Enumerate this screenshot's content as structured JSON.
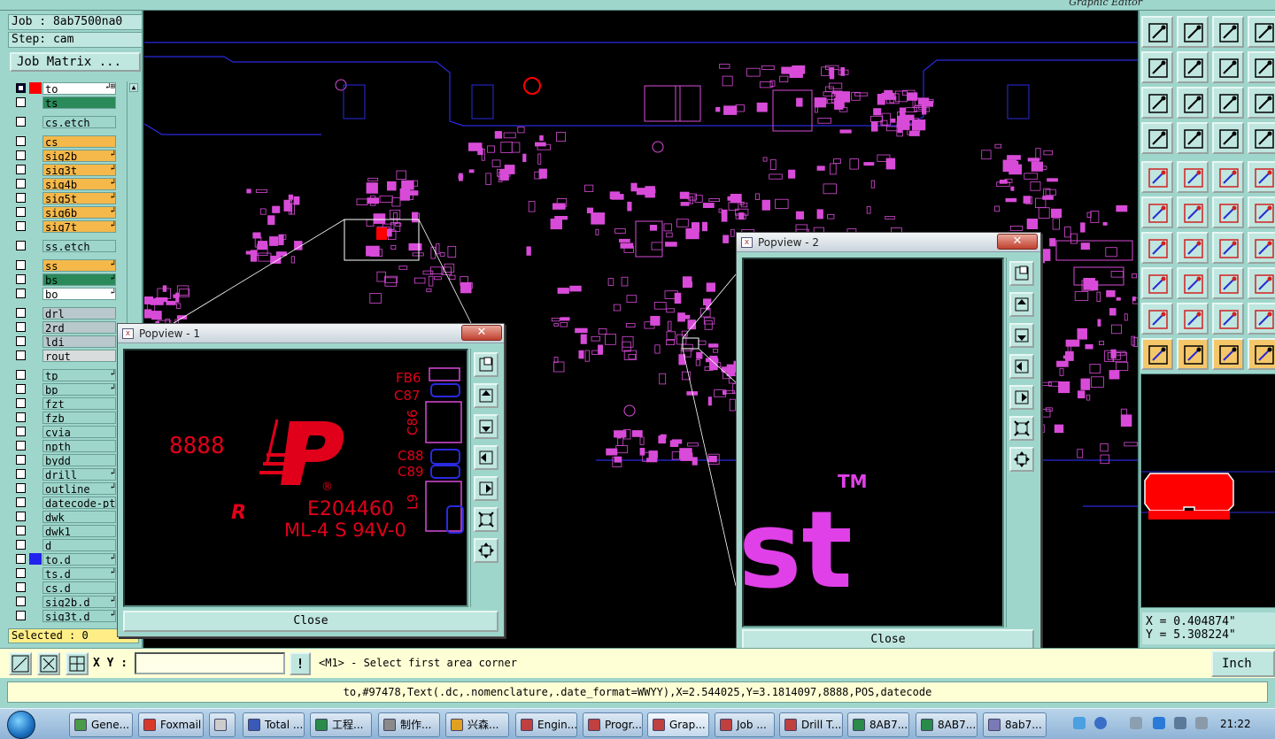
{
  "app": {
    "window_title": "Graphic Editor"
  },
  "job": {
    "job_label": "Job : 8ab7500na0",
    "step_label": "Step: cam",
    "matrix_button": "Job Matrix ..."
  },
  "colors": {
    "panel": "#9fd6cc",
    "accent_orange": "#f5b84a",
    "accent_green": "#2a8a5a",
    "layer_cyan": "#9fd6cc",
    "board_magenta": "#d84bd8",
    "board_blue": "#2a2ae0",
    "feature_red": "#ff0000"
  },
  "layers": [
    {
      "name": "to",
      "bg": "#ffffff",
      "swatch": "#ff0000",
      "on": true,
      "flag": "↲⊞"
    },
    {
      "name": "ts",
      "bg": "#2a8a5a",
      "swatch": "",
      "on": false,
      "flag": ""
    },
    {
      "name": "cs.etch",
      "bg": "#9fd6cc",
      "swatch": "",
      "on": false,
      "flag": ""
    },
    {
      "name": "cs",
      "bg": "#f5b84a",
      "swatch": "",
      "on": false,
      "flag": ""
    },
    {
      "name": "sig2b",
      "bg": "#f5b84a",
      "swatch": "",
      "on": false,
      "flag": "↲"
    },
    {
      "name": "sig3t",
      "bg": "#f5b84a",
      "swatch": "",
      "on": false,
      "flag": "↲"
    },
    {
      "name": "sig4b",
      "bg": "#f5b84a",
      "swatch": "",
      "on": false,
      "flag": "↲"
    },
    {
      "name": "sig5t",
      "bg": "#f5b84a",
      "swatch": "",
      "on": false,
      "flag": "↲"
    },
    {
      "name": "sig6b",
      "bg": "#f5b84a",
      "swatch": "",
      "on": false,
      "flag": "↲"
    },
    {
      "name": "sig7t",
      "bg": "#f5b84a",
      "swatch": "",
      "on": false,
      "flag": "↲"
    },
    {
      "name": "ss.etch",
      "bg": "#9fd6cc",
      "swatch": "",
      "on": false,
      "flag": ""
    },
    {
      "name": "ss",
      "bg": "#f5b84a",
      "swatch": "",
      "on": false,
      "flag": "↲"
    },
    {
      "name": "bs",
      "bg": "#2a8a5a",
      "swatch": "",
      "on": false,
      "flag": "↲"
    },
    {
      "name": "bo",
      "bg": "#ffffff",
      "swatch": "",
      "on": false,
      "flag": "↲"
    },
    {
      "name": "drl",
      "bg": "#b9c8cc",
      "swatch": "",
      "on": false,
      "flag": ""
    },
    {
      "name": "2rd",
      "bg": "#b9c8cc",
      "swatch": "",
      "on": false,
      "flag": ""
    },
    {
      "name": "ldi",
      "bg": "#b9c8cc",
      "swatch": "",
      "on": false,
      "flag": ""
    },
    {
      "name": "rout",
      "bg": "#d9dcdc",
      "swatch": "",
      "on": false,
      "flag": ""
    },
    {
      "name": "tp",
      "bg": "#9fd6cc",
      "swatch": "",
      "on": false,
      "flag": "↲"
    },
    {
      "name": "bp",
      "bg": "#9fd6cc",
      "swatch": "",
      "on": false,
      "flag": "↲"
    },
    {
      "name": "fzt",
      "bg": "#9fd6cc",
      "swatch": "",
      "on": false,
      "flag": ""
    },
    {
      "name": "fzb",
      "bg": "#9fd6cc",
      "swatch": "",
      "on": false,
      "flag": ""
    },
    {
      "name": "cvia",
      "bg": "#9fd6cc",
      "swatch": "",
      "on": false,
      "flag": ""
    },
    {
      "name": "npth",
      "bg": "#9fd6cc",
      "swatch": "",
      "on": false,
      "flag": ""
    },
    {
      "name": "bydd",
      "bg": "#9fd6cc",
      "swatch": "",
      "on": false,
      "flag": ""
    },
    {
      "name": "drill",
      "bg": "#9fd6cc",
      "swatch": "",
      "on": false,
      "flag": "↲"
    },
    {
      "name": "outline",
      "bg": "#9fd6cc",
      "swatch": "",
      "on": false,
      "flag": "↲"
    },
    {
      "name": "datecode-pte",
      "bg": "#9fd6cc",
      "swatch": "",
      "on": false,
      "flag": ""
    },
    {
      "name": "dwk",
      "bg": "#9fd6cc",
      "swatch": "",
      "on": false,
      "flag": ""
    },
    {
      "name": "dwk1",
      "bg": "#9fd6cc",
      "swatch": "",
      "on": false,
      "flag": ""
    },
    {
      "name": "d",
      "bg": "#9fd6cc",
      "swatch": "",
      "on": false,
      "flag": ""
    },
    {
      "name": "to.d",
      "bg": "#9fd6cc",
      "swatch": "#2222ee",
      "on": false,
      "flag": "↲"
    },
    {
      "name": "ts.d",
      "bg": "#9fd6cc",
      "swatch": "",
      "on": false,
      "flag": "↲"
    },
    {
      "name": "cs.d",
      "bg": "#9fd6cc",
      "swatch": "",
      "on": false,
      "flag": ""
    },
    {
      "name": "sig2b.d",
      "bg": "#9fd6cc",
      "swatch": "",
      "on": false,
      "flag": "↲"
    },
    {
      "name": "sig3t.d",
      "bg": "#9fd6cc",
      "swatch": "",
      "on": false,
      "flag": "↲"
    }
  ],
  "selected_label": "Selected : 0",
  "popview1": {
    "title": "Popview - 1",
    "close_x": "✕",
    "close_button": "Close",
    "marking": {
      "digits": "8888",
      "cert": "E204460",
      "rating": "ML-4 S 94V-0",
      "ul": "R",
      "reg": "®"
    },
    "refdes": [
      "FB6",
      "C87",
      "C86",
      "C88",
      "C89",
      "L9"
    ]
  },
  "popview2": {
    "title": "Popview - 2",
    "close_x": "✕",
    "close_button": "Close",
    "logo_text": "st",
    "tm": "TM"
  },
  "coords": {
    "x": "X = 0.404874\"",
    "y": "Y = 5.308224\""
  },
  "command": {
    "xy_label": "X Y :",
    "xy_value": "",
    "excl": "!",
    "prompt": "<M1> - Select first area corner",
    "units": "Inch"
  },
  "status": {
    "text": "to,#97478,Text(.dc,.nomenclature,.date_format=WWYY),X=2.544025,Y=3.1814097,8888,POS,datecode"
  },
  "taskbar": {
    "items": [
      {
        "label": "Gene...",
        "color": "#4a9a4a"
      },
      {
        "label": "Foxmail",
        "color": "#d83a2a"
      },
      {
        "label": "",
        "color": "#ccc"
      },
      {
        "label": "Total ...",
        "color": "#3a5ab8"
      },
      {
        "label": "工程...",
        "color": "#2a8a4a"
      },
      {
        "label": "制作...",
        "color": "#8a8a8a"
      },
      {
        "label": "兴森...",
        "color": "#e0a020"
      },
      {
        "label": "Engin...",
        "color": "#c04040"
      },
      {
        "label": "Progr...",
        "color": "#c04040"
      },
      {
        "label": "Grap...",
        "color": "#c04040"
      },
      {
        "label": "Job ...",
        "color": "#c04040"
      },
      {
        "label": "Drill T...",
        "color": "#c04040"
      },
      {
        "label": "8AB7...",
        "color": "#2a8a4a"
      },
      {
        "label": "8AB7...",
        "color": "#2a8a4a"
      },
      {
        "label": "8ab7...",
        "color": "#7a7ab8"
      }
    ],
    "clock": "21:22"
  }
}
